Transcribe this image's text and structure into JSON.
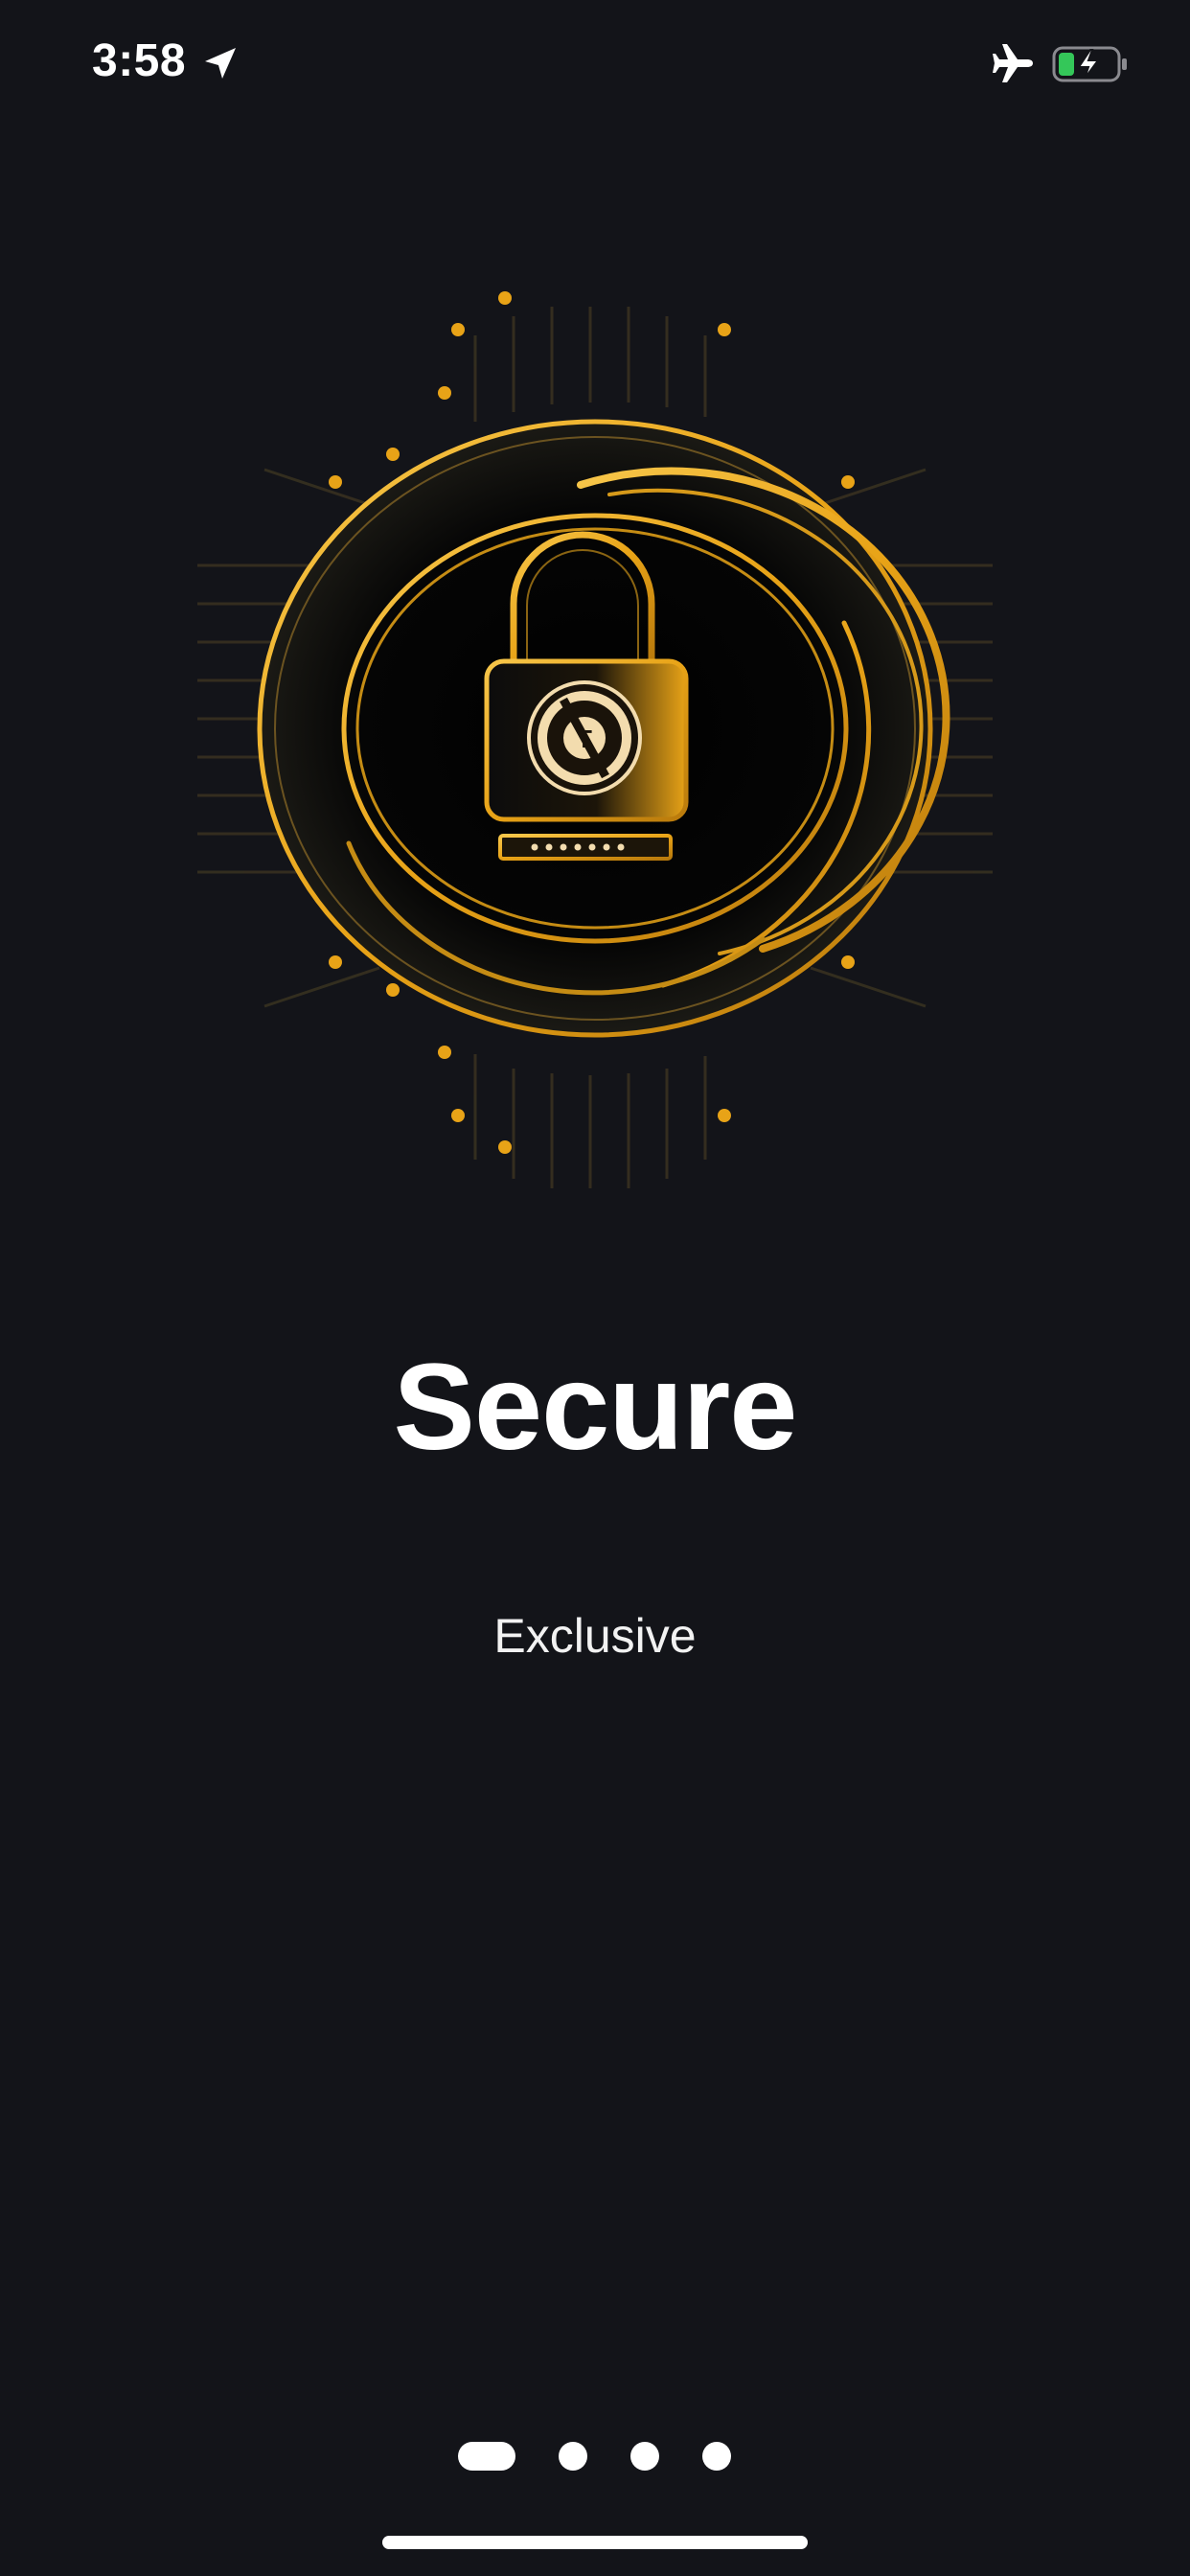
{
  "status_bar": {
    "time": "3:58",
    "icons": [
      "location-arrow-icon",
      "airplane-icon",
      "battery-charging-icon"
    ],
    "battery_color": "#34c759"
  },
  "onboarding": {
    "illustration": "padlock-circuit-icon",
    "title": "Secure",
    "subtitle": "Exclusive",
    "pages": 4,
    "current_page": 1
  },
  "colors": {
    "background": "#131419",
    "accent_gold": "#e8a317",
    "text": "#ffffff"
  }
}
